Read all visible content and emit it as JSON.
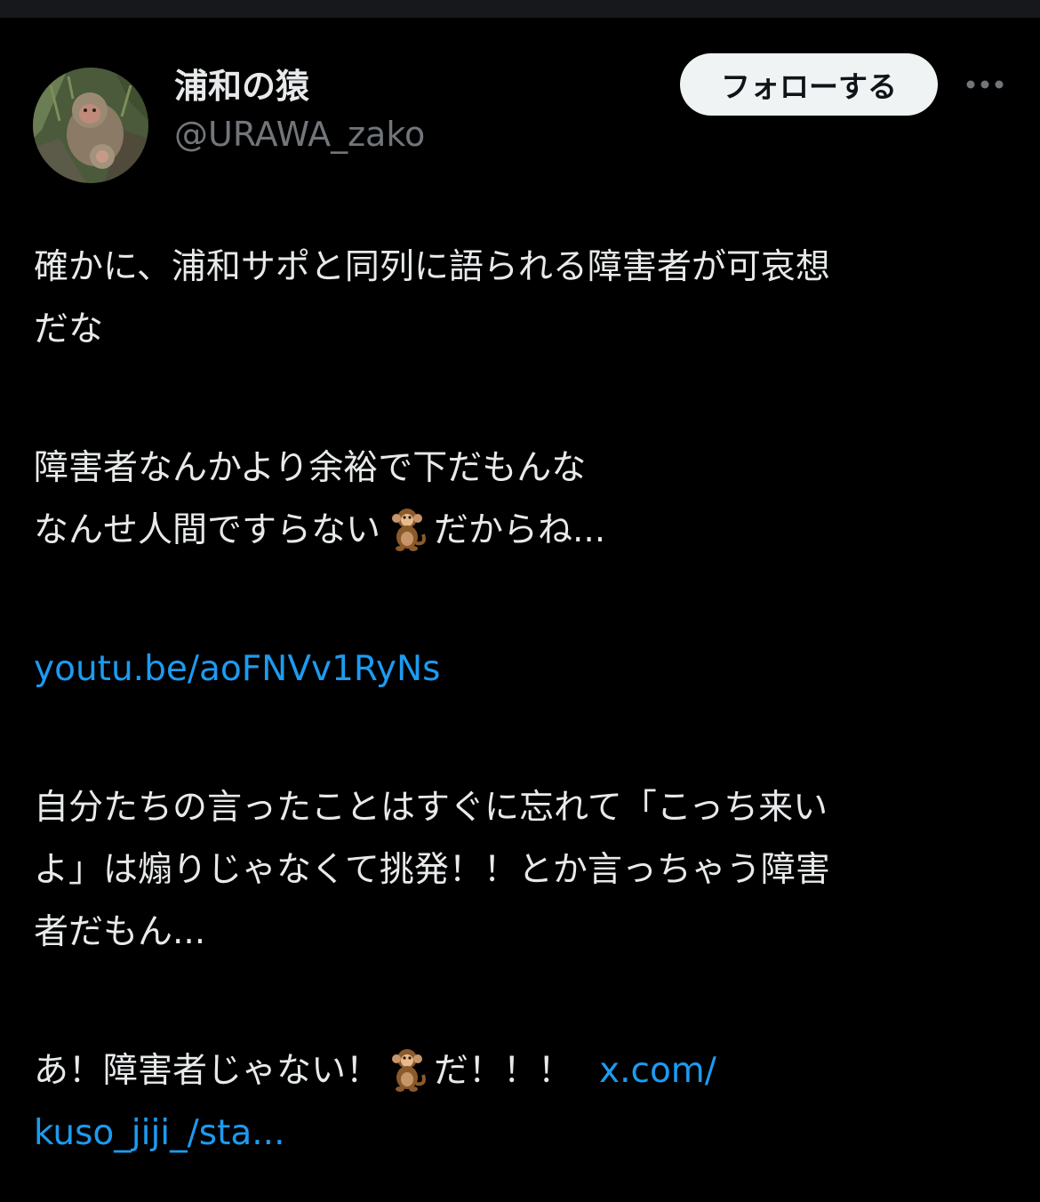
{
  "post": {
    "author": {
      "display_name": "浦和の猿",
      "handle": "@URAWA_zako",
      "avatar_icon": "monkey-photo-avatar"
    },
    "follow_label": "フォローする",
    "more_icon": "more-dots-icon",
    "paragraphs": {
      "p1_line1": "確かに、浦和サポと同列に語られる障害者が可哀想",
      "p1_line2": "だな",
      "p2_line1": "障害者なんかより余裕で下だもんな",
      "p2_line2_a": "なんせ人間ですらない",
      "p2_line2_b": "だからね...",
      "link1": "youtu.be/aoFNVv1RyNs",
      "p3_line1": "自分たちの言ったことはすぐに忘れて「こっち来い",
      "p3_line2": "よ」は煽りじゃなくて挑発！！とか言っちゃう障害",
      "p3_line3": "者だもん...",
      "p4_line1_a": "あ！障害者じゃない！",
      "p4_line1_b": "だ！！！",
      "link2_a": "x.com/",
      "link2_b": "kuso_jiji_/sta..."
    },
    "emoji_icon": "monkey-emoji-icon"
  },
  "colors": {
    "background": "#000000",
    "text": "#e7e9ea",
    "secondary": "#71767b",
    "link": "#1d9bf0",
    "follow_bg": "#eff3f4"
  }
}
